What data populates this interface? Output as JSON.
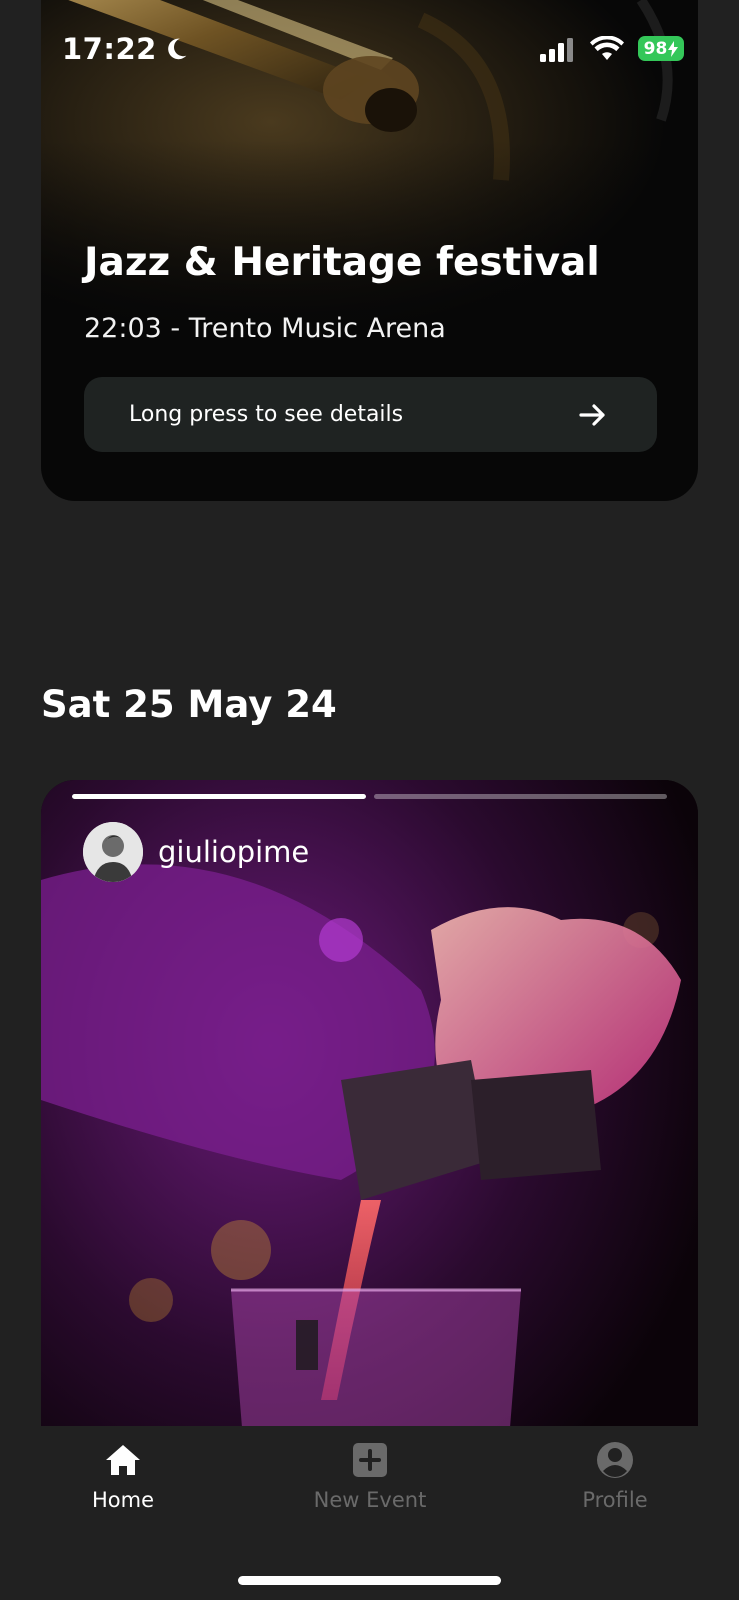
{
  "status_bar": {
    "time": "17:22",
    "battery": "98"
  },
  "event": {
    "title": "Jazz & Heritage festival",
    "subtitle": "22:03 - Trento Music Arena",
    "button_label": "Long press to see details"
  },
  "date_header": "Sat 25 May 24",
  "story": {
    "username": "giuliopime",
    "segments": [
      {
        "progress": 1.0
      },
      {
        "progress": 0.0
      }
    ]
  },
  "nav": {
    "items": [
      {
        "label": "Home",
        "icon": "home-icon",
        "active": true
      },
      {
        "label": "New Event",
        "icon": "plus-square-icon",
        "active": false
      },
      {
        "label": "Profile",
        "icon": "account-circle-icon",
        "active": false
      }
    ]
  },
  "colors": {
    "background": "#212121",
    "battery": "#34c759",
    "button_bg": "#1f2322",
    "nav_inactive": "#6a6a6a"
  }
}
